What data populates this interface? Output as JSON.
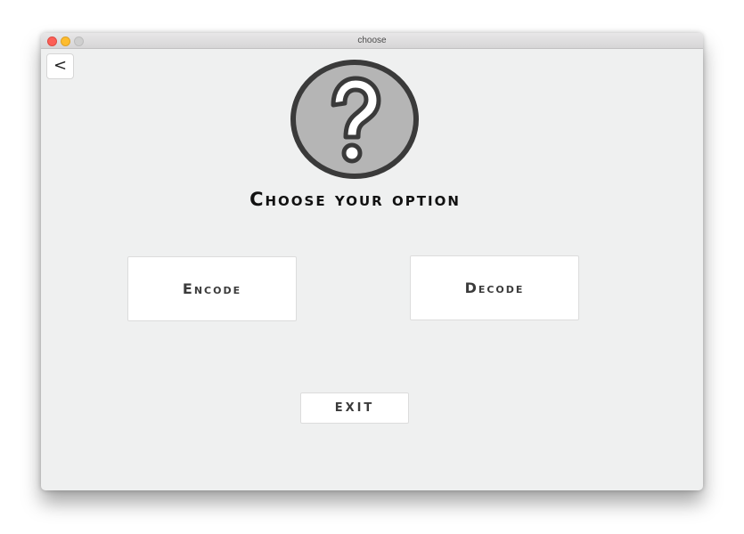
{
  "window": {
    "title": "choose"
  },
  "toolbar": {
    "back_label": "<"
  },
  "main": {
    "icon": "help-question-icon",
    "heading": "Choose your option",
    "encode_label": "Encode",
    "decode_label": "Decode",
    "exit_label": "EXIT"
  },
  "colors": {
    "window_background": "#eff0f0",
    "icon_fill": "#b5b5b5",
    "icon_stroke": "#3a3a3a",
    "button_background": "#ffffff",
    "close_dot": "#fc5f57",
    "minimize_dot": "#fdbc2e",
    "zoom_dot": "#cfcfcf"
  }
}
